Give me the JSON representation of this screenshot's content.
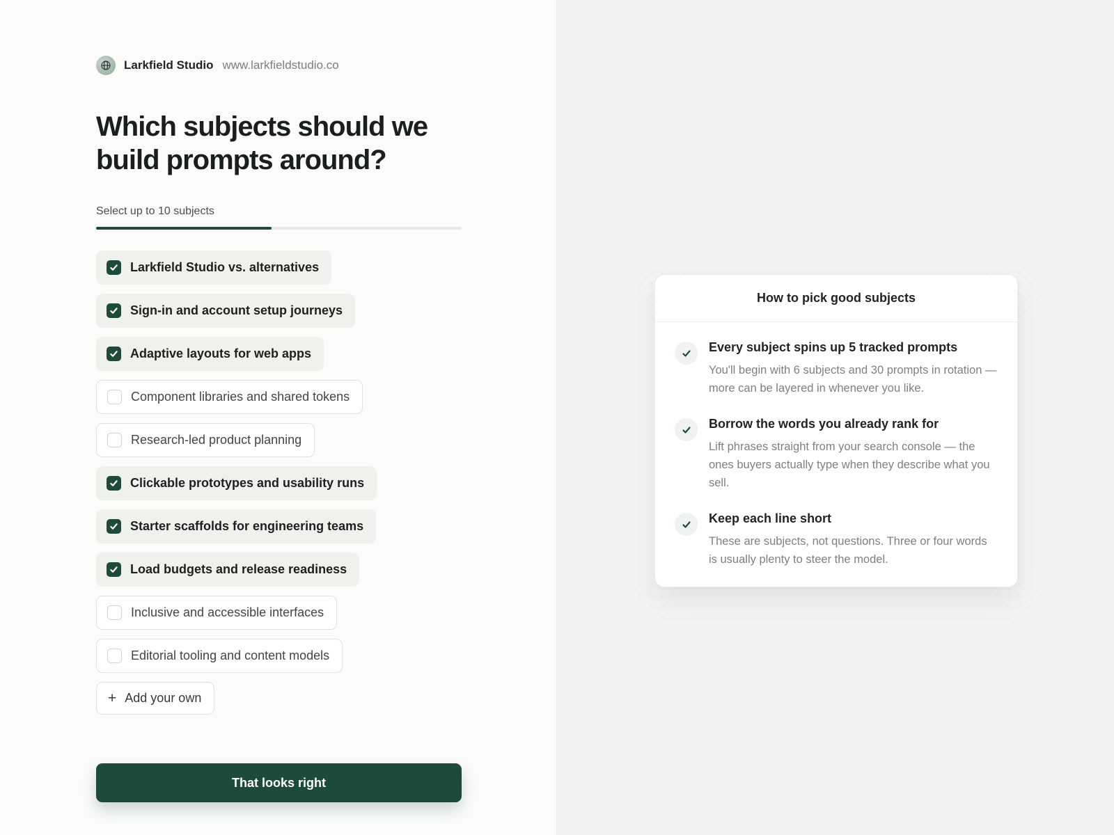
{
  "brand": {
    "name": "Larkfield Studio",
    "url": "www.larkfieldstudio.co",
    "logo_icon": "globe-icon"
  },
  "heading": "Which subjects should we build prompts around?",
  "subhead": "Select up to 10 subjects",
  "progress": {
    "fraction": 0.48,
    "color": "#1e4a3a"
  },
  "subjects": [
    {
      "label": "Larkfield Studio vs. alternatives",
      "checked": true
    },
    {
      "label": "Sign-in and account setup journeys",
      "checked": true
    },
    {
      "label": "Adaptive layouts for web apps",
      "checked": true
    },
    {
      "label": "Component libraries and shared tokens",
      "checked": false
    },
    {
      "label": "Research-led product planning",
      "checked": false
    },
    {
      "label": "Clickable prototypes and usability runs",
      "checked": true
    },
    {
      "label": "Starter scaffolds for engineering teams",
      "checked": true
    },
    {
      "label": "Load budgets and release readiness",
      "checked": true
    },
    {
      "label": "Inclusive and accessible interfaces",
      "checked": false
    },
    {
      "label": "Editorial tooling and content models",
      "checked": false
    }
  ],
  "add_own_label": "Add your own",
  "cta_label": "That looks right",
  "tips_card": {
    "title": "How to pick good subjects",
    "tips": [
      {
        "title": "Every subject spins up 5 tracked prompts",
        "body": "You'll begin with 6 subjects and 30 prompts in rotation — more can be layered in whenever you like."
      },
      {
        "title": "Borrow the words you already rank for",
        "body": "Lift phrases straight from your search console — the ones buyers actually type when they describe what you sell."
      },
      {
        "title": "Keep each line short",
        "body": "These are subjects, not questions. Three or four words is usually plenty to steer the model."
      }
    ]
  },
  "colors": {
    "accent": "#1e4a3a",
    "checked_chip_bg": "#eff1ed",
    "panel_bg": "#fbfcf9"
  }
}
